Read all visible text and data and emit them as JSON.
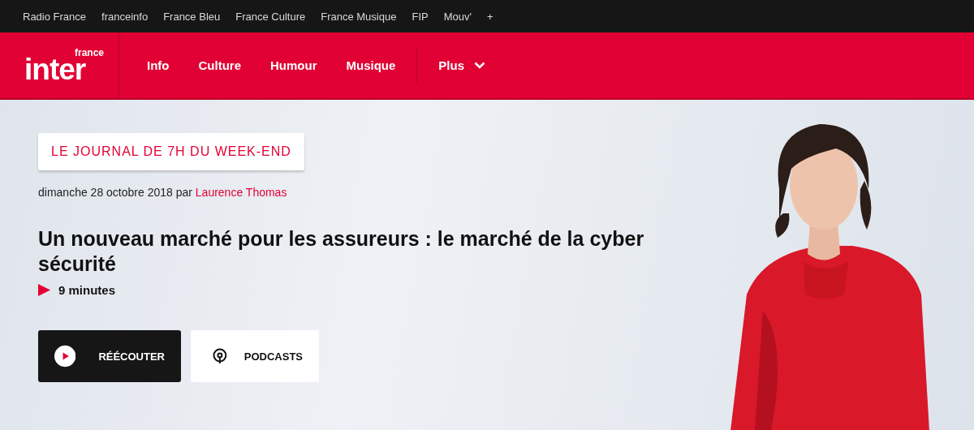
{
  "network_bar": {
    "links": [
      "Radio France",
      "franceinfo",
      "France Bleu",
      "France Culture",
      "France Musique",
      "FIP",
      "Mouv'",
      "+"
    ]
  },
  "header": {
    "logo": {
      "small": "france",
      "main": "inter"
    },
    "nav": [
      "Info",
      "Culture",
      "Humour",
      "Musique"
    ],
    "more": "Plus"
  },
  "episode": {
    "show": "LE JOURNAL DE 7H DU WEEK-END",
    "date": "dimanche 28 octobre 2018 par",
    "author": "Laurence Thomas",
    "title": "Un nouveau marché pour les assureurs : le marché de la cyber sécurité",
    "duration": "9 minutes",
    "buttons": [
      {
        "kind": "play",
        "label": "RÉÉCOUTER"
      },
      {
        "kind": "podcast",
        "label": "PODCASTS"
      }
    ]
  }
}
